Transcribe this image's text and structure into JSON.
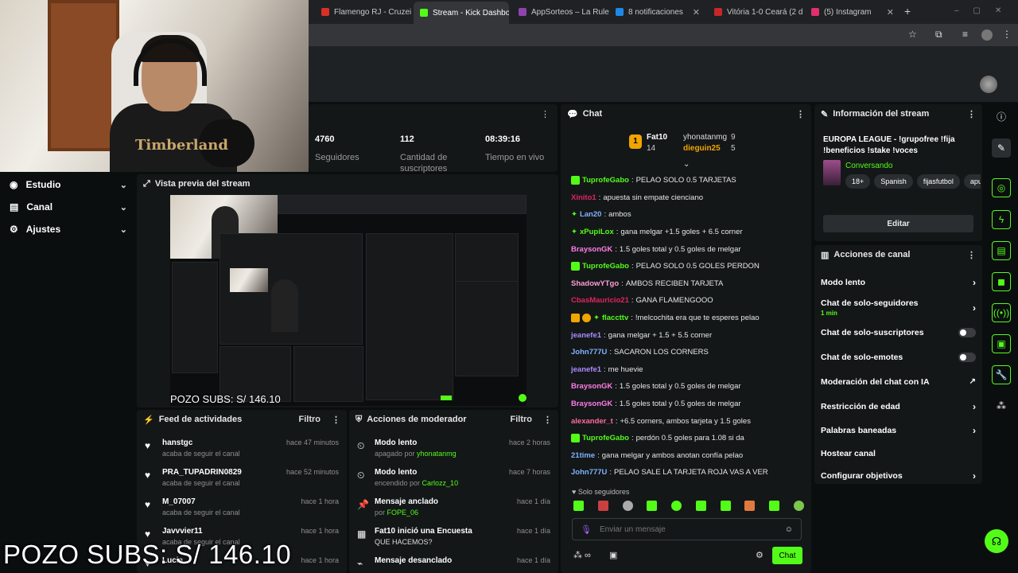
{
  "browser": {
    "tabs": [
      {
        "label": "Flamengo RJ - Cruzei",
        "color": "#d93025",
        "active": false
      },
      {
        "label": "Stream - Kick Dashbo",
        "color": "#53fc18",
        "active": true
      },
      {
        "label": "AppSorteos – La Rule",
        "color": "#8e44ad",
        "active": false
      },
      {
        "label": "8 notificaciones",
        "color": "#1e88e5",
        "active": false
      },
      {
        "label": "Vitória 1-0 Ceará (2 d",
        "color": "#c62828",
        "active": false
      },
      {
        "label": "(5) Instagram",
        "color": "#e1306c",
        "active": false
      }
    ]
  },
  "overlay": {
    "shirt_text": "Timberland",
    "pozo_small": "POZO SUBS: S/ 146.10",
    "pozo_big": "POZO SUBS: S/ 146.10"
  },
  "nav": {
    "items": [
      {
        "label": "Estudio",
        "icon": "studio-icon"
      },
      {
        "label": "Canal",
        "icon": "channel-icon"
      },
      {
        "label": "Ajustes",
        "icon": "gear-icon"
      }
    ]
  },
  "stats": {
    "followers": {
      "value": "4760",
      "label": "Seguidores"
    },
    "subs": {
      "value": "112",
      "label": "Cantidad de suscriptores"
    },
    "live": {
      "value": "08:39:16",
      "label": "Tiempo en vivo"
    }
  },
  "preview": {
    "title": "Vista previa del stream"
  },
  "activity": {
    "title": "Feed de actividades",
    "filter": "Filtro",
    "items": [
      {
        "user": "hanstgc",
        "desc": "acaba de seguir el canal",
        "time": "hace 47 minutos"
      },
      {
        "user": "PRA_TUPADRIN0829",
        "desc": "acaba de seguir el canal",
        "time": "hace 52 minutos"
      },
      {
        "user": "M_07007",
        "desc": "acaba de seguir el canal",
        "time": "hace 1 hora"
      },
      {
        "user": "Javvvier11",
        "desc": "acaba de seguir el canal",
        "time": "hace 1 hora"
      },
      {
        "user": "Lucia",
        "desc": "",
        "time": "hace 1 hora"
      }
    ]
  },
  "moderator": {
    "title": "Acciones de moderador",
    "filter": "Filtro",
    "items": [
      {
        "title": "Modo lento",
        "pre": "apagado por ",
        "by": "yhonatanmg",
        "time": "hace 2 horas",
        "icon": "slow-mode-icon"
      },
      {
        "title": "Modo lento",
        "pre": "encendido por ",
        "by": "Carlozz_10",
        "time": "hace 7 horas",
        "icon": "slow-mode-icon"
      },
      {
        "title": "Mensaje anclado",
        "pre": "por ",
        "by": "FOPE_06",
        "time": "hace 1 día",
        "icon": "pin-icon"
      },
      {
        "title": "Fat10 inició una Encuesta",
        "pre": "",
        "by": "QUE HACEMOS?",
        "time": "hace 1 día",
        "icon": "poll-icon"
      },
      {
        "title": "Mensaje desanclado",
        "pre": "",
        "by": "",
        "time": "hace 1 día",
        "icon": "unpin-icon"
      }
    ]
  },
  "chat": {
    "title": "Chat",
    "leaders": [
      {
        "rank": "1",
        "name": "Fat10",
        "count": "14"
      },
      {
        "name": "yhonatanmg",
        "count": "9"
      },
      {
        "name": "dieguin25",
        "count": "5"
      }
    ],
    "messages": [
      {
        "user": "TuprofeGabo",
        "color": "#53fc18",
        "text": "PELAO SOLO 0.5 TARJETAS"
      },
      {
        "user": "Xinito1",
        "color": "#e0245e",
        "text": "apuesta sin empate cienciano"
      },
      {
        "user": "Lan20",
        "color": "#7fb2ff",
        "text": "ambos"
      },
      {
        "user": "xPupiLox",
        "color": "#53fc18",
        "text": "gana melgar +1.5 goles + 6.5 corner"
      },
      {
        "user": "BraysonGK",
        "color": "#ff7de9",
        "text": "1.5 goles total y 0.5 goles de melgar"
      },
      {
        "user": "TuprofeGabo",
        "color": "#53fc18",
        "text": "PELAO SOLO 0.5 GOLES PERDON"
      },
      {
        "user": "ShadowYTgo",
        "color": "#ff9dd6",
        "text": "AMBOS RECIBEN TARJETA"
      },
      {
        "user": "CbasMauricio21",
        "color": "#e0245e",
        "text": "GANA FLAMENGOOO"
      },
      {
        "user": "flaccttv",
        "color": "#53fc18",
        "text": "!melcochita era que te esperes pelao"
      },
      {
        "user": "jeanefe1",
        "color": "#a98bff",
        "text": "gana melgar + 1.5 + 5.5 corner"
      },
      {
        "user": "John777U",
        "color": "#7fb2ff",
        "text": "SACARON LOS CORNERS"
      },
      {
        "user": "jeanefe1",
        "color": "#a98bff",
        "text": "me huevie"
      },
      {
        "user": "BraysonGK",
        "color": "#ff7de9",
        "text": "1.5 goles total y 0.5 goles de melgar"
      },
      {
        "user": "BraysonGK",
        "color": "#ff7de9",
        "text": "1.5 goles total y 0.5 goles de melgar"
      },
      {
        "user": "alexander_t",
        "color": "#ff6b9b",
        "text": "+6.5 corners, ambos tarjeta y 1.5 goles"
      },
      {
        "user": "TuprofeGabo",
        "color": "#53fc18",
        "text": "perdón 0.5 goles para 1.08 si da"
      },
      {
        "user": "21time",
        "color": "#7fb2ff",
        "text": "gana melgar y ambos anotan confía pelao"
      },
      {
        "user": "John777U",
        "color": "#7fb2ff",
        "text": "PELAO SALE LA TARJETA ROJA VAS A VER"
      }
    ],
    "mode": "Solo seguidores",
    "placeholder": "Enviar un mensaje",
    "send": "Chat"
  },
  "streaminfo": {
    "title": "Información del stream",
    "stream_title": "EUROPA LEAGUE - !grupofree !fija !beneficios !stake !voces",
    "category": "Conversando",
    "tags": [
      "18+",
      "Spanish",
      "fijasfutbol",
      "apues"
    ],
    "edit": "Editar"
  },
  "channel": {
    "title": "Acciones de canal",
    "slow": "Modo lento",
    "followers_only": "Chat de solo-seguidores",
    "followers_only_sub": "1 min",
    "subs_only": "Chat de solo-suscriptores",
    "emotes_only": "Chat de solo-emotes",
    "ai_mod": "Moderación del chat con IA",
    "age": "Restricción de edad",
    "banned": "Palabras baneadas",
    "host": "Hostear canal",
    "goals": "Configurar objetivos"
  },
  "colors": {
    "accent": "#53fc18",
    "panel": "#141718",
    "bg": "#0b0e0f"
  }
}
